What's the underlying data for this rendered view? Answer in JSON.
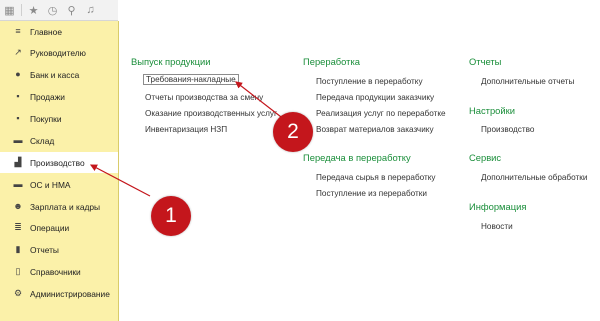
{
  "toolbar": {
    "icons": [
      "apps-grid-icon",
      "star-icon",
      "history-icon",
      "search-icon",
      "bell-icon"
    ]
  },
  "sidebar": {
    "items": [
      {
        "label": "Главное",
        "icon": "menu-icon",
        "glyph": "≡"
      },
      {
        "label": "Руководителю",
        "icon": "trend-icon",
        "glyph": "↗"
      },
      {
        "label": "Банк и касса",
        "icon": "coin-icon",
        "glyph": "●"
      },
      {
        "label": "Продажи",
        "icon": "bag-icon",
        "glyph": "▪"
      },
      {
        "label": "Покупки",
        "icon": "cart-icon",
        "glyph": "▪"
      },
      {
        "label": "Склад",
        "icon": "warehouse-icon",
        "glyph": "▬"
      },
      {
        "label": "Производство",
        "icon": "factory-icon",
        "glyph": "▟"
      },
      {
        "label": "ОС и НМА",
        "icon": "truck-icon",
        "glyph": "▬"
      },
      {
        "label": "Зарплата и кадры",
        "icon": "people-icon",
        "glyph": "☻"
      },
      {
        "label": "Операции",
        "icon": "operations-icon",
        "glyph": "≣"
      },
      {
        "label": "Отчеты",
        "icon": "bar-chart-icon",
        "glyph": "▮"
      },
      {
        "label": "Справочники",
        "icon": "book-icon",
        "glyph": "▯"
      },
      {
        "label": "Администрирование",
        "icon": "gear-icon",
        "glyph": "⚙"
      }
    ],
    "active_index": 6
  },
  "content": {
    "sections": [
      {
        "title": "Выпуск продукции",
        "links": [
          "Требования-накладные",
          "Отчеты производства за смену",
          "Оказание производственных услуг",
          "Инвентаризация НЗП"
        ]
      },
      {
        "title": "Переработка",
        "links": [
          "Поступление в переработку",
          "Передача продукции заказчику",
          "Реализация услуг по переработке",
          "Возврат материалов заказчику"
        ]
      },
      {
        "title": "Передача в переработку",
        "links": [
          "Передача сырья в переработку",
          "Поступление из переработки"
        ]
      },
      {
        "title": "Отчеты",
        "links": [
          "Дополнительные отчеты"
        ]
      },
      {
        "title": "Настройки",
        "links": [
          "Производство"
        ]
      },
      {
        "title": "Сервис",
        "links": [
          "Дополнительные обработки"
        ]
      },
      {
        "title": "Информация",
        "links": [
          "Новости"
        ]
      }
    ]
  },
  "annotations": [
    {
      "label": "1"
    },
    {
      "label": "2"
    }
  ],
  "colors": {
    "sidebar_bg": "#fbf1a9",
    "section_title": "#1a8e3a",
    "annotation_red": "#c4161c"
  }
}
